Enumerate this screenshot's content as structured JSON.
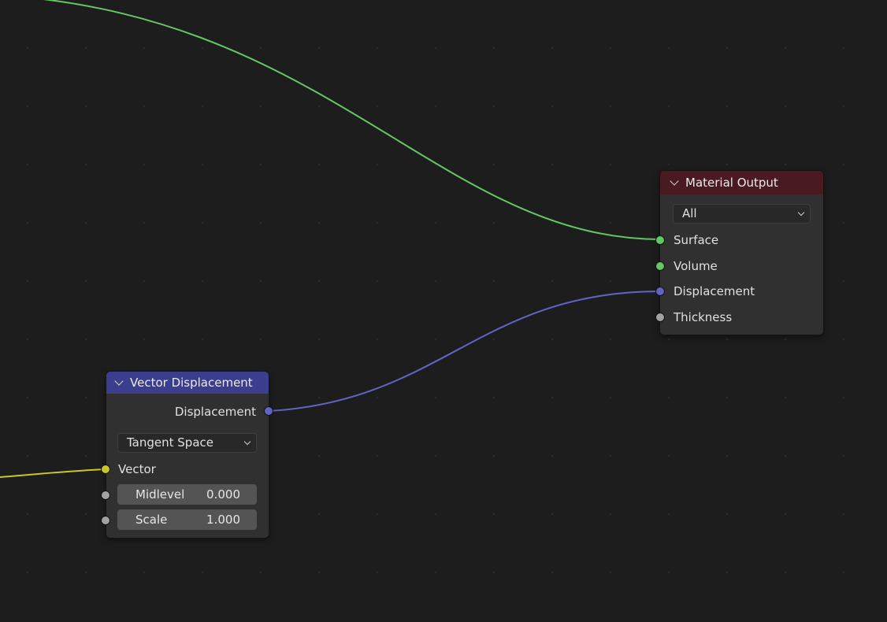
{
  "colors": {
    "background": "#1d1d1d",
    "node_body": "#303030",
    "shader_link": "#63c763",
    "vector_link": "#6363c7",
    "color_link": "#c7c729",
    "float_socket": "#a1a1a1",
    "material_output_header": "#4a1a22",
    "vector_displacement_header": "#3b3e8c"
  },
  "material_output": {
    "title": "Material Output",
    "target_select": "All",
    "inputs": {
      "surface": "Surface",
      "volume": "Volume",
      "displacement": "Displacement",
      "thickness": "Thickness"
    }
  },
  "vector_displacement": {
    "title": "Vector Displacement",
    "output_displacement": "Displacement",
    "space_select": "Tangent Space",
    "input_vector": "Vector",
    "midlevel": {
      "label": "Midlevel",
      "value": "0.000"
    },
    "scale": {
      "label": "Scale",
      "value": "1.000"
    }
  }
}
